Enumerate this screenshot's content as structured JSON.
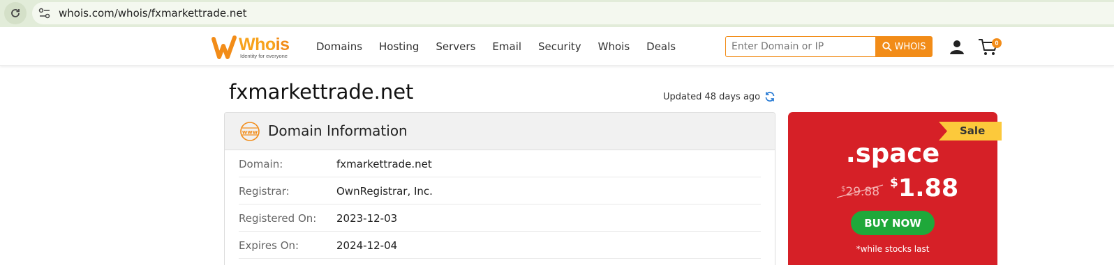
{
  "browser": {
    "url": "whois.com/whois/fxmarkettrade.net"
  },
  "header": {
    "logo_text_a": "Who",
    "logo_text_b": "is",
    "logo_tagline": "Identity for everyone",
    "nav": [
      "Domains",
      "Hosting",
      "Servers",
      "Email",
      "Security",
      "Whois",
      "Deals"
    ],
    "search": {
      "placeholder": "Enter Domain or IP",
      "value": "",
      "button_label": "WHOIS"
    },
    "cart_count": "0"
  },
  "main": {
    "title": "fxmarkettrade.net",
    "updated": "Updated 48 days ago",
    "card_title": "Domain Information",
    "rows": [
      {
        "label": "Domain:",
        "value": "fxmarkettrade.net"
      },
      {
        "label": "Registrar:",
        "value": "OwnRegistrar, Inc."
      },
      {
        "label": "Registered On:",
        "value": "2023-12-03"
      },
      {
        "label": "Expires On:",
        "value": "2024-12-04"
      }
    ]
  },
  "promo": {
    "badge": "Sale",
    "tld": ".space",
    "old_currency": "$",
    "old_price": "29.88",
    "new_currency": "$",
    "new_price": "1.88",
    "button_label": "BUY NOW",
    "note": "*while stocks last"
  },
  "colors": {
    "brand_orange": "#f28c18",
    "promo_red": "#d62027",
    "sale_yellow": "#fcc93b",
    "buy_green": "#1fa83a"
  },
  "icons": [
    "reload-icon",
    "site-info-icon",
    "search-icon",
    "user-icon",
    "cart-icon",
    "www-icon",
    "refresh-icon"
  ]
}
